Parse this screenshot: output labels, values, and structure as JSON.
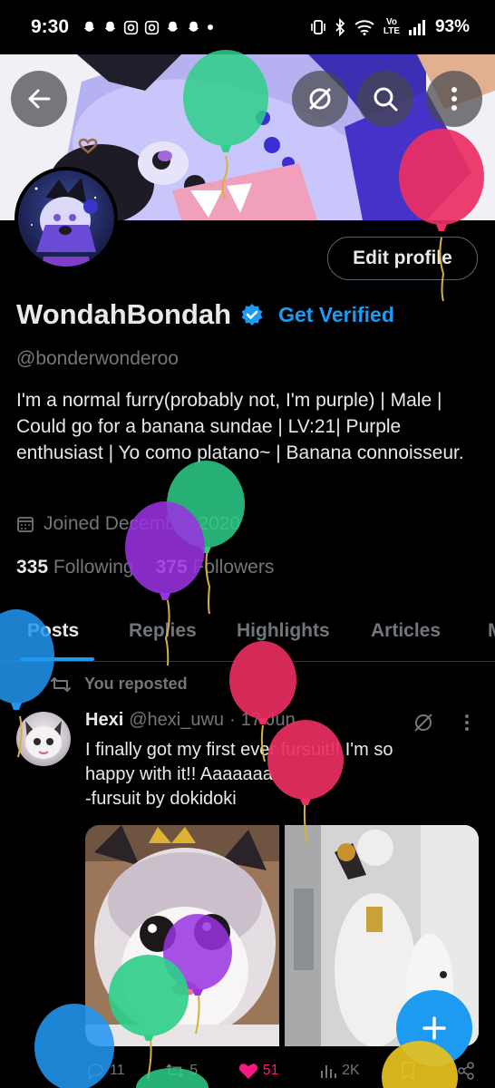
{
  "status_bar": {
    "time": "9:30",
    "battery": "93%",
    "network_label": "Vo LTE"
  },
  "profile": {
    "display_name": "WondahBondah",
    "get_verified": "Get Verified",
    "handle": "@bonderwonderoo",
    "bio": "I'm a normal furry(probably not, I'm purple) | Male | Could go for a banana sundae | LV:21| Purple enthusiast | Yo como platano~ | Banana connoisseur.",
    "joined": "Joined December 2020",
    "following_count": "335",
    "following_label": "Following",
    "followers_count": "375",
    "followers_label": "Followers",
    "edit_button": "Edit profile"
  },
  "tabs": [
    {
      "label": "Posts",
      "active": true
    },
    {
      "label": "Replies",
      "active": false
    },
    {
      "label": "Highlights",
      "active": false
    },
    {
      "label": "Articles",
      "active": false
    },
    {
      "label": "M",
      "active": false
    }
  ],
  "post": {
    "repost_label": "You reposted",
    "author": "Hexi",
    "author_handle": "@hexi_uwu",
    "separator": "·",
    "date": "17 Jun",
    "text_line1": "I finally got my first ever fursuit!! I'm so",
    "text_line2": "happy with it!! Aaaaaaa",
    "text_line3": "-fursuit by dokidoki",
    "replies": "11",
    "reposts": "5",
    "likes": "51",
    "views": "2K"
  },
  "colors": {
    "accent": "#1d9bf0",
    "like": "#f91880",
    "muted": "#71767b",
    "text": "#e7e9ea",
    "background": "#000000"
  }
}
